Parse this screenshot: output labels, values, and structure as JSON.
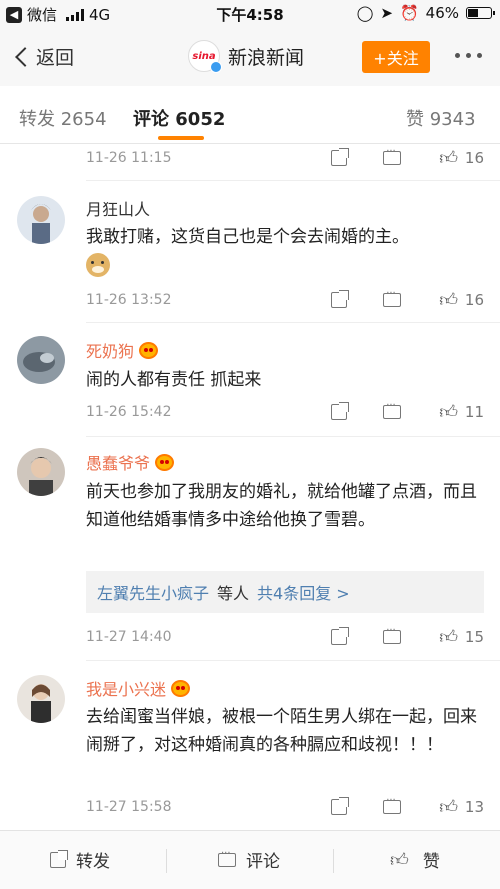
{
  "status_bar": {
    "carrier": "微信",
    "network": "4G",
    "time": "下午4:58",
    "battery": "46%",
    "battery_level": 0.46
  },
  "nav": {
    "back_label": "返回",
    "account_name": "新浪新闻",
    "logo_text": "sina",
    "follow_label": "+关注"
  },
  "tabs": [
    {
      "label": "转发 2654"
    },
    {
      "label": "评论 6052"
    },
    {
      "label": "赞 9343"
    }
  ],
  "comments": [
    {
      "date": "11-26 11:15",
      "likes": "16"
    },
    {
      "name": "月狂山人",
      "text": "我敢打赌，这货自己也是个会去闹婚的主。",
      "date": "11-26 13:52",
      "likes": "16"
    },
    {
      "name": "死奶狗",
      "text": "闹的人都有责任  抓起来",
      "date": "11-26 15:42",
      "likes": "11"
    },
    {
      "name": "愚蠢爷爷",
      "text": "前天也参加了我朋友的婚礼，就给他罐了点酒，而且知道他结婚事情多中途给他换了雪碧。",
      "reply_user": "左翼先生小疯子",
      "reply_mid": "等人",
      "reply_count": "共4条回复 >",
      "date": "11-27 14:40",
      "likes": "15"
    },
    {
      "name": "我是小兴迷",
      "text": "去给闺蜜当伴娘，被根一个陌生男人绑在一起，回来闹掰了，对这种婚闹真的各种膈应和歧视！！！",
      "date": "11-27 15:58",
      "likes": "13"
    }
  ],
  "bottom_bar": {
    "share": "转发",
    "comment": "评论",
    "like": "赞"
  }
}
